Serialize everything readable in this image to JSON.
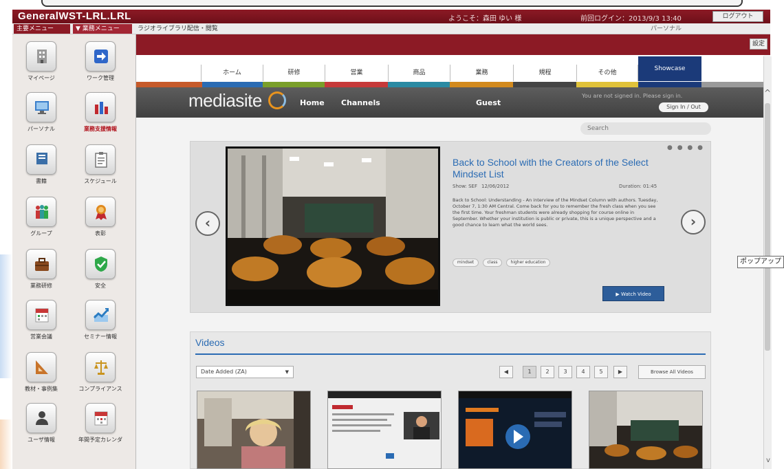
{
  "app": {
    "title": "GeneralWST-LRL.LRL",
    "user_info": "ようこそ：森田 ゆい 様",
    "login_info": "前回ログイン：2013/9/3 13:40",
    "logout_label": "ログアウト",
    "band_button": "設定"
  },
  "subbar": {
    "tab1": "主要メニュー",
    "tab2": "▼ 業務メニュー",
    "breadcrumb": "ラジオライブラリ配信・閲覧",
    "right": "パーソナル"
  },
  "sidebar": {
    "items": [
      {
        "label": "マイページ",
        "icon": "building-icon",
        "color": "#8c8c8c"
      },
      {
        "label": "ワーク管理",
        "icon": "arrow-right-icon",
        "color": "#2f67c9"
      },
      {
        "label": "パーソナル",
        "icon": "monitor-icon",
        "color": "#3a7fcb"
      },
      {
        "label": "業務支援情報",
        "icon": "bar-chart-icon",
        "color": "#c0292f"
      },
      {
        "label": "書籍",
        "icon": "book-icon",
        "color": "#3b6fa8"
      },
      {
        "label": "スケジュール",
        "icon": "clipboard-icon",
        "color": "#777777"
      },
      {
        "label": "グループ",
        "icon": "people-icon",
        "color": "#2e9a9a"
      },
      {
        "label": "表彰",
        "icon": "award-icon",
        "color": "#e08a1f"
      },
      {
        "label": "業務研修",
        "icon": "briefcase-icon",
        "color": "#8a4a1f"
      },
      {
        "label": "安全",
        "icon": "shield-icon",
        "color": "#2ea84a"
      },
      {
        "label": "営業会議",
        "icon": "calendar-icon",
        "color": "#c83737"
      },
      {
        "label": "セミナー情報",
        "icon": "line-chart-icon",
        "color": "#2a7cc2"
      },
      {
        "label": "教材・事例集",
        "icon": "ruler-icon",
        "color": "#c8742a"
      },
      {
        "label": "コンプライアンス",
        "icon": "scales-icon",
        "color": "#c9941e"
      },
      {
        "label": "ユーザ情報",
        "icon": "person-icon",
        "color": "#444444"
      },
      {
        "label": "年間予定カレンダ",
        "icon": "calendar2-icon",
        "color": "#c83737"
      }
    ]
  },
  "site_nav": {
    "items": [
      "ホーム",
      "研修",
      "営業",
      "商品",
      "業務",
      "規程",
      "その他",
      "Showcase"
    ]
  },
  "mediasite": {
    "logo": "mediasite",
    "nav": [
      "Home",
      "Channels",
      "Guest"
    ],
    "signin_text": "You are not signed in. Please sign in.",
    "signin_button": "Sign In / Out"
  },
  "search": {
    "placeholder": "Search"
  },
  "featured": {
    "title": "Back to School with the Creators of the Select Mindset List",
    "presenter": "Show: SEF",
    "date": "12/06/2012",
    "duration": "Duration: 01:45",
    "description": "Back to School: Understanding - An interview of the Mindset Column with authors. Tuesday, October 7, 1:30 AM Central. Come back for you to remember the fresh class when you see the first time. Your freshman students were already shopping for course online in September. Whether your institution is public or private, this is a unique perspective and a good chance to learn what the world sees.",
    "tags": [
      "mindset",
      "class",
      "higher education"
    ],
    "view_button": "▶ Watch Video",
    "dots": "● ● ● ●"
  },
  "videos": {
    "title": "Videos",
    "sort_label": "Date Added (ZA)",
    "pagination": [
      "◀",
      "1",
      "2",
      "3",
      "4",
      "5",
      "▶"
    ],
    "browse_button": "Browse All Videos"
  },
  "side_tooltip": "ポップアップ"
}
